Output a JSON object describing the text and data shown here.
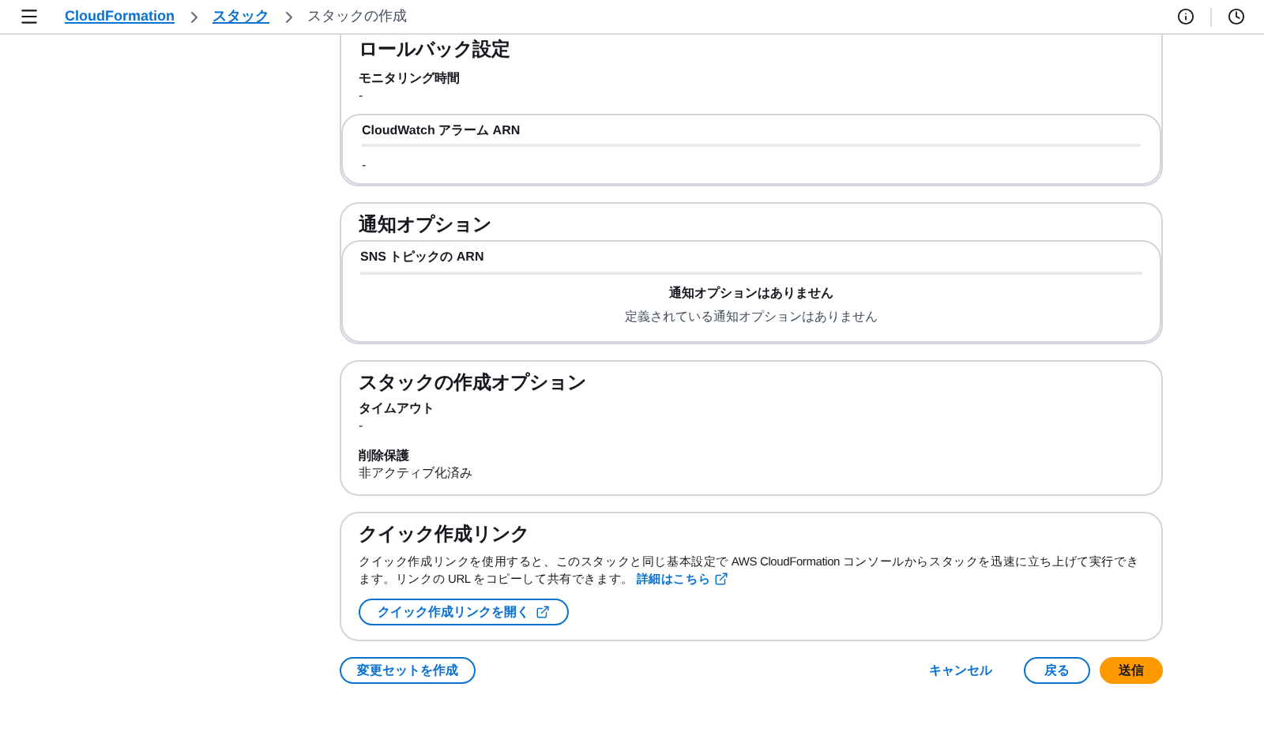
{
  "breadcrumbs": [
    {
      "label": "CloudFormation",
      "link": true
    },
    {
      "label": "スタック",
      "link": true
    },
    {
      "label": "スタックの作成",
      "link": false
    }
  ],
  "rollback": {
    "title": "ロールバック設定",
    "monitoring_label": "モニタリング時間",
    "monitoring_value": "-",
    "alarm_header": "CloudWatch アラーム ARN",
    "alarm_value": "-"
  },
  "notifications": {
    "title": "通知オプション",
    "table_header": "SNS トピックの ARN",
    "empty_title": "通知オプションはありません",
    "empty_text": "定義されている通知オプションはありません"
  },
  "stack_options": {
    "title": "スタックの作成オプション",
    "fields": [
      {
        "label": "タイムアウト",
        "value": "-"
      },
      {
        "label": "削除保護",
        "value": "非アクティブ化済み"
      }
    ]
  },
  "quick_link": {
    "title": "クイック作成リンク",
    "description": "クイック作成リンクを使用すると、このスタックと同じ基本設定で AWS CloudFormation コンソールからスタックを迅速に立ち上げて実行できます。リンクの URL をコピーして共有できます。",
    "learn_more": "詳細はこちら",
    "button": "クイック作成リンクを開く"
  },
  "footer": {
    "changeset": "変更セットを作成",
    "cancel": "キャンセル",
    "back": "戻る",
    "submit": "送信"
  }
}
